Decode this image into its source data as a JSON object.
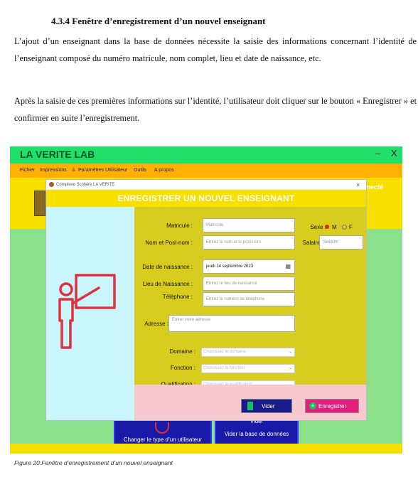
{
  "document": {
    "heading": "4.3.4 Fenêtre d’enregistrement d’un nouvel enseignant",
    "paragraph_1": "L’ajout d’un enseignant dans la base de données nécessite la saisie des informations concernant l’identité de l’enseignant composé du numéro matricule, nom complet, lieu et date de naissance, etc.",
    "paragraph_2": "Après la saisie de ces premières informations sur l’identité, l’utilisateur doit cliquer sur le bouton « Enregistrer » et confirmer en suite l’enregistrement.",
    "caption": "Figure 20:Fenêtre d’enregistrement d’un nouvel enseignant"
  },
  "app": {
    "title": "LA VERITE LAB",
    "minimize": "–",
    "close": "X",
    "menu": [
      "Fichier",
      "Impressions",
      "Paramètres Utilisateur",
      "Outils",
      "A propos"
    ],
    "brand_partial": "nnecté",
    "bottom_left_button": "Changer le  type d’un utilisateur",
    "bottom_right_button_top": "Vider",
    "bottom_right_button": "Vider la base de données"
  },
  "dialog": {
    "window_title": "Complexe Scolaire LA VERITE",
    "close": "×",
    "header": "ENREGISTRER UN NOUVEL ENSEIGNANT",
    "fields": {
      "matricule_label": "Matricule :",
      "matricule_placeholder": "Matricule",
      "nom_label": "Nom et Post-nom :",
      "nom_placeholder": "Entrez le nom et le post-nom",
      "date_label": "Date de naissance :",
      "date_value": "jeudi 14 septembre 2023",
      "lieu_label": "Lieu de Naissance :",
      "lieu_placeholder": "Entrez le lieu de naissance",
      "tel_label": "Téléphone :",
      "tel_placeholder": "Entrez le numéro de téléphone",
      "adresse_label": "Adresse :",
      "adresse_placeholder": "Entrer votre adresse",
      "sexe_label": "Sexe :",
      "sexe_m": "M",
      "sexe_f": "F",
      "salaire_label": "Salaire :",
      "salaire_placeholder": "Salaire",
      "domaine_label": "Domaine :",
      "domaine_placeholder": "Choisissez le domaine",
      "fonction_label": "Fonction :",
      "fonction_placeholder": "Choisissez la fonction",
      "qualification_label": "Qualification :",
      "qualification_placeholder": "Choisissez la qualification"
    },
    "buttons": {
      "vider": "Vider",
      "enregistrer": "Enregistrer"
    }
  },
  "colors": {
    "titlebar": "#20e06a",
    "menubar": "#ffb000",
    "header": "#f7e000",
    "form": "#d8cd1f",
    "left_pane": "#c8f6fb",
    "button_pane": "#f8c8d0",
    "vider_button": "#1a1a8a",
    "enregistrer_button": "#e0207a",
    "teacher_icon": "#e03040"
  },
  "icons": [
    "teacher-board-icon",
    "calendar-icon",
    "trash-icon",
    "plus-icon",
    "school-logo-icon"
  ]
}
